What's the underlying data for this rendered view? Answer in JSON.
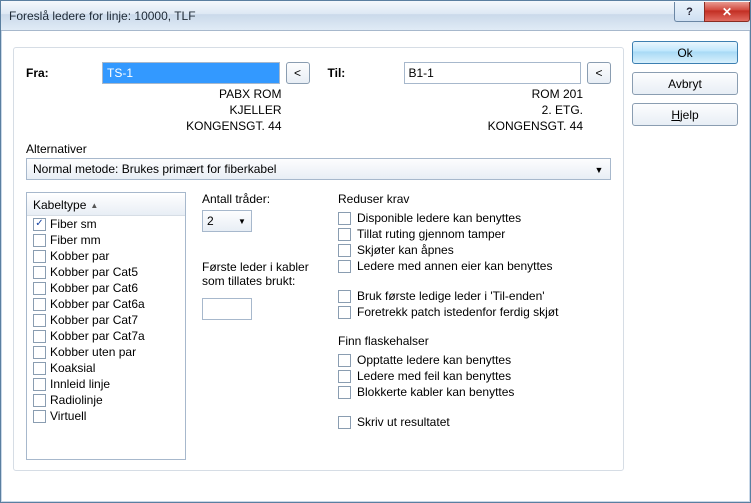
{
  "window": {
    "title": "Foreslå ledere for linje: 10000, TLF"
  },
  "buttons": {
    "ok": "Ok",
    "cancel": "Avbryt",
    "help": "Hjelp"
  },
  "from": {
    "label": "Fra:",
    "value": "TS-1",
    "addr1": "PABX ROM",
    "addr2": "KJELLER",
    "addr3": "KONGENSGT. 44",
    "browse": "<"
  },
  "to": {
    "label": "Til:",
    "value": "B1-1",
    "addr1": "ROM 201",
    "addr2": "2. ETG.",
    "addr3": "KONGENSGT. 44",
    "browse": "<"
  },
  "alt": {
    "label": "Alternativer",
    "selected": "Normal metode: Brukes primært for fiberkabel"
  },
  "cabletype": {
    "header": "Kabeltype",
    "items": [
      {
        "label": "Fiber sm",
        "checked": true
      },
      {
        "label": "Fiber mm",
        "checked": false
      },
      {
        "label": "Kobber par",
        "checked": false
      },
      {
        "label": "Kobber par Cat5",
        "checked": false
      },
      {
        "label": "Kobber par Cat6",
        "checked": false
      },
      {
        "label": "Kobber par Cat6a",
        "checked": false
      },
      {
        "label": "Kobber par Cat7",
        "checked": false
      },
      {
        "label": "Kobber par Cat7a",
        "checked": false
      },
      {
        "label": "Kobber uten par",
        "checked": false
      },
      {
        "label": "Koaksial",
        "checked": false
      },
      {
        "label": "Innleid linje",
        "checked": false
      },
      {
        "label": "Radiolinje",
        "checked": false
      },
      {
        "label": "Virtuell",
        "checked": false
      }
    ]
  },
  "threads": {
    "label": "Antall tråder:",
    "value": "2"
  },
  "firstleader": {
    "label": "Første leder i kabler som tillates brukt:",
    "value": ""
  },
  "reduce": {
    "title": "Reduser krav",
    "items": [
      "Disponible ledere kan benyttes",
      "Tillat ruting gjennom tamper",
      "Skjøter kan åpnes",
      "Ledere med annen eier kan benyttes"
    ]
  },
  "tilend": {
    "items": [
      "Bruk første ledige leder i 'Til-enden'",
      "Foretrekk patch istedenfor ferdig skjøt"
    ]
  },
  "bottleneck": {
    "title": "Finn flaskehalser",
    "items": [
      "Opptatte ledere kan benyttes",
      "Ledere med feil kan benyttes",
      "Blokkerte kabler kan benyttes"
    ]
  },
  "print": {
    "label": "Skriv ut resultatet"
  }
}
